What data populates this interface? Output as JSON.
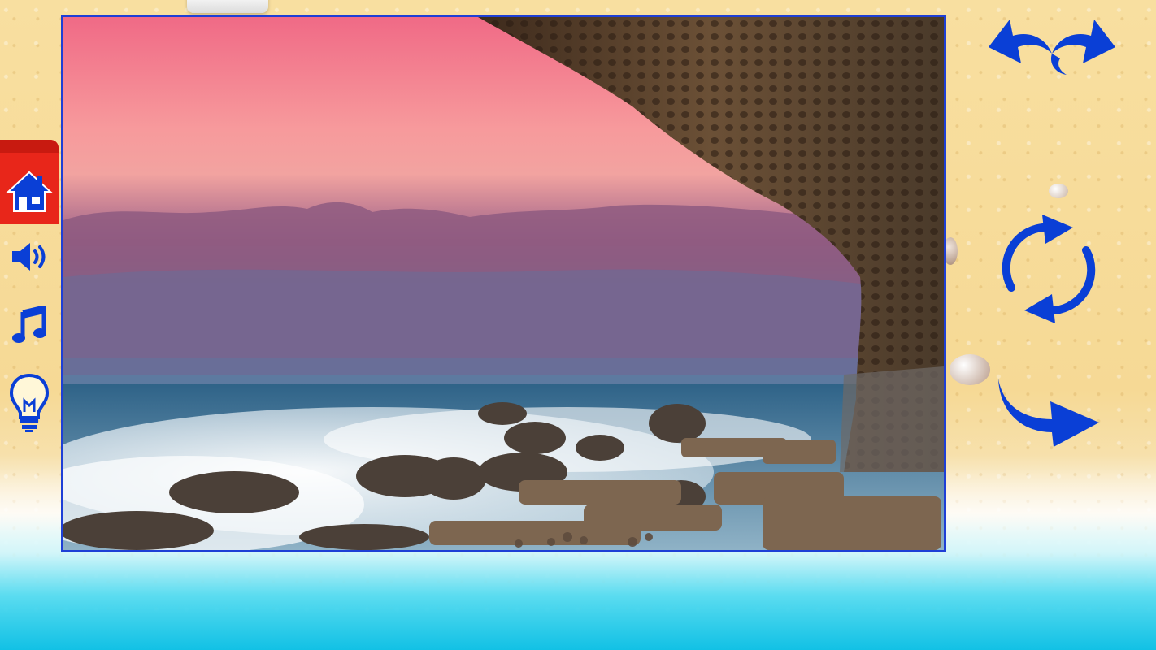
{
  "game": {
    "screen": "jigsaw-puzzle-preview",
    "puzzle_image": {
      "subject": "sea-cave-sunset",
      "colors": {
        "sky_top": "#f07a8c",
        "sky_mid": "#f6a4a4",
        "cloud": "#9a5f86",
        "sea": "#3b6a8c",
        "mist": "#e9eef2",
        "rock": "#5a4a3c",
        "cliff": "#7a5a3a"
      }
    },
    "left_menu": [
      {
        "icon": "home-icon"
      },
      {
        "icon": "speaker-icon"
      },
      {
        "icon": "music-note-icon"
      },
      {
        "icon": "lightbulb-hint-icon"
      }
    ],
    "right_menu": [
      {
        "icon": "undo-redo-icon"
      },
      {
        "icon": "shuffle-rotate-icon"
      },
      {
        "icon": "next-arrow-icon"
      }
    ],
    "accent_color": "#0a3fd6",
    "frame_color": "#1e3fd6",
    "ribbon_color": "#e8261a"
  }
}
